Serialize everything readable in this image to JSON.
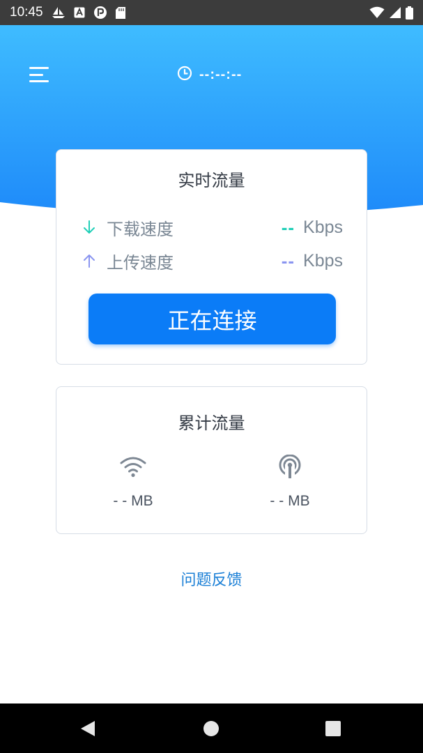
{
  "status_bar": {
    "time": "10:45",
    "left_icons": [
      "boat-icon",
      "font-a-icon",
      "p-badge-icon",
      "sd-card-icon"
    ],
    "right_icons": [
      "wifi-icon",
      "cell-signal-icon",
      "battery-icon"
    ]
  },
  "header": {
    "gradient_top": "#3fbcff",
    "gradient_bottom": "#1e8af9",
    "timer_icon": "clock-icon",
    "timer_text": "--:--:--"
  },
  "realtime": {
    "title": "实时流量",
    "download": {
      "icon": "arrow-down-icon",
      "label": "下载速度",
      "value": "--",
      "unit": "Kbps",
      "color": "#1fcfb7"
    },
    "upload": {
      "icon": "arrow-up-icon",
      "label": "上传速度",
      "value": "--",
      "unit": "Kbps",
      "color": "#8a95f0"
    },
    "connect_button": "正在连接"
  },
  "cumulative": {
    "title": "累计流量",
    "wifi": {
      "icon": "wifi-icon",
      "value": "- - MB"
    },
    "mobile": {
      "icon": "cellular-antenna-icon",
      "value": "- - MB"
    }
  },
  "feedback_link": "问题反馈",
  "nav_bar": {
    "buttons": [
      "back-icon",
      "home-icon",
      "recents-icon"
    ]
  },
  "colors": {
    "accent": "#0b7cf7",
    "link": "#1a7fd6",
    "card_border": "#d6dde6",
    "muted_text": "#7a8794"
  }
}
